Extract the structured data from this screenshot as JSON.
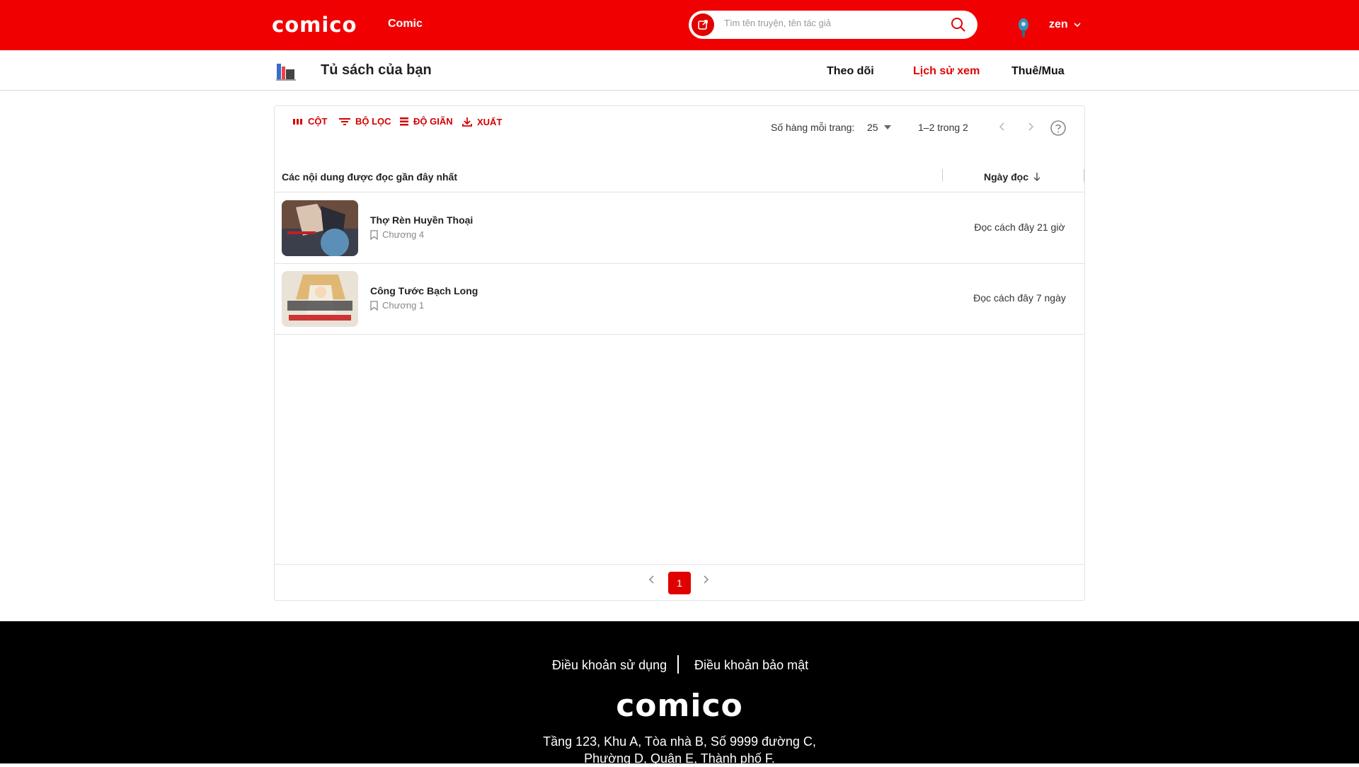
{
  "header": {
    "logo": "comico",
    "nav_comic": "Comic",
    "search_placeholder": "Tìm tên truyện, tên tác giả",
    "username": "zen"
  },
  "subheader": {
    "title": "Tủ sách của bạn",
    "tabs": [
      {
        "label": "Theo dõi",
        "active": false
      },
      {
        "label": "Lịch sử xem",
        "active": true
      },
      {
        "label": "Thuê/Mua",
        "active": false
      }
    ]
  },
  "toolbar": {
    "columns": "CỘT",
    "filter": "BỘ LỌC",
    "density": "ĐỘ GIÃN",
    "export": "XUẤT",
    "rows_per_page_label": "Số hàng mỗi trang:",
    "rows_per_page_value": "25",
    "range": "1–2 trong 2"
  },
  "table": {
    "col_content": "Các nội dung được đọc gần đây nhất",
    "col_date": "Ngày đọc",
    "rows": [
      {
        "title": "Thợ Rèn Huyền Thoại",
        "chapter": "Chương 4",
        "date": "Đọc cách đây 21 giờ"
      },
      {
        "title": "Công Tước Bạch Long",
        "chapter": "Chương 1",
        "date": "Đọc cách đây 7 ngày"
      }
    ]
  },
  "pager": {
    "current": "1"
  },
  "footer": {
    "terms": "Điều khoản sử dụng",
    "privacy": "Điều khoản bảo mật",
    "logo": "comico",
    "address_line1": "Tầng 123, Khu A, Tòa nhà B, Số 9999 đường C,",
    "address_line2": "Phường D, Quận E, Thành phố F."
  },
  "colors": {
    "brand": "#f00000",
    "footer_bg": "#000000"
  }
}
